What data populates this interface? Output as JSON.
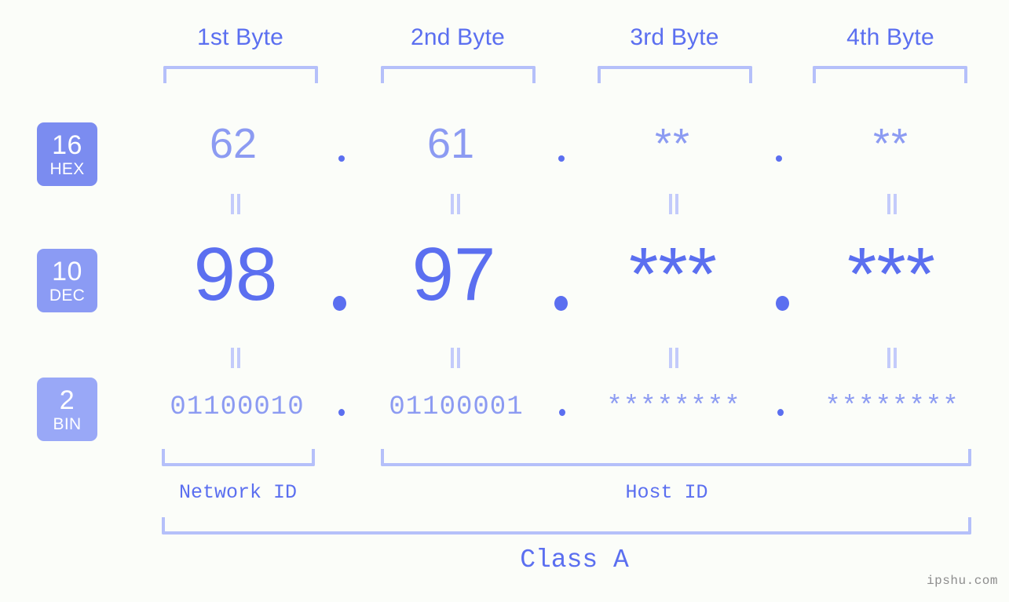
{
  "meta": {
    "watermark": "ipshu.com",
    "colors": {
      "background": "#fbfdf9",
      "accent_strong": "#5b6ff0",
      "accent_mid": "#8c9bf2",
      "accent_light": "#b5c0fa",
      "badge_hex": "#7b8cf0",
      "badge_dec": "#8b9bf4",
      "badge_bin": "#99a8f7",
      "watermark_gray": "#8d8d8d"
    }
  },
  "byte_headers": [
    {
      "label": "1st Byte"
    },
    {
      "label": "2nd Byte"
    },
    {
      "label": "3rd Byte"
    },
    {
      "label": "4th Byte"
    }
  ],
  "radix_rows": [
    {
      "badge_number": "16",
      "badge_abbr": "HEX",
      "values": [
        "62",
        "61",
        "**",
        "**"
      ],
      "separator": "."
    },
    {
      "badge_number": "10",
      "badge_abbr": "DEC",
      "values": [
        "98",
        "97",
        "***",
        "***"
      ],
      "separator": "."
    },
    {
      "badge_number": "2",
      "badge_abbr": "BIN",
      "values": [
        "01100010",
        "01100001",
        "********",
        "********"
      ],
      "separator": "."
    }
  ],
  "equals_marks": {
    "glyph": "=",
    "count": 8
  },
  "id_sections": [
    {
      "label": "Network ID"
    },
    {
      "label": "Host ID"
    }
  ],
  "class_section": {
    "label": "Class A"
  }
}
